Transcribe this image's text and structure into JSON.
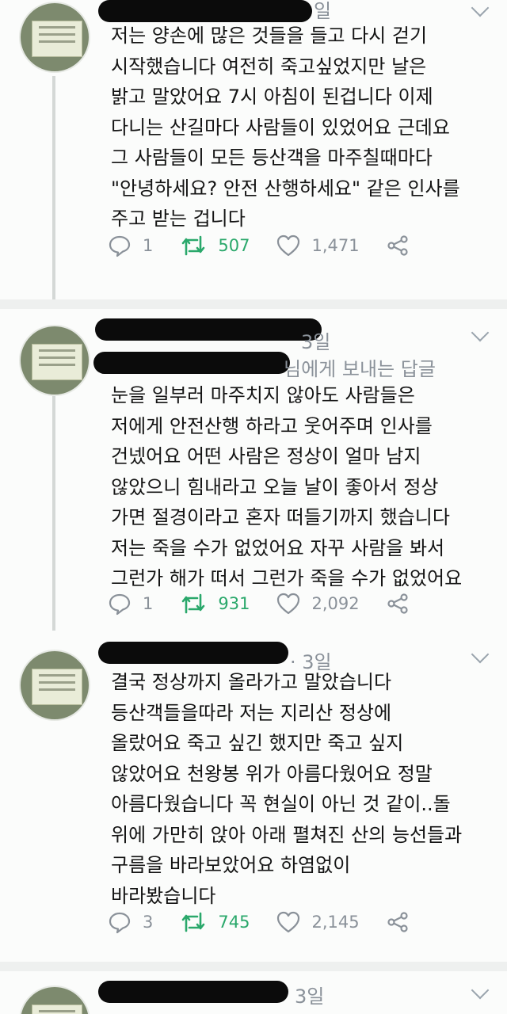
{
  "tweets": [
    {
      "time": "일",
      "body": [
        "저는 양손에 많은 것들을 들고 다시 걷기",
        "시작했습니다 여전히 죽고싶었지만 날은",
        "밝고 말았어요 7시 아침이 된겁니다 이제",
        "다니는 산길마다 사람들이 있었어요 근데요",
        "그 사람들이 모든 등산객을 마주칠때마다",
        "\"안녕하세요? 안전 산행하세요\" 같은 인사를",
        "주고 받는 겁니다"
      ],
      "replies": "1",
      "retweets": "507",
      "likes": "1,471"
    },
    {
      "time": "3일",
      "reply_to": "님에게 보내는 답글",
      "body": [
        "눈을 일부러 마주치지 않아도 사람들은",
        "저에게 안전산행 하라고 웃어주며 인사를",
        "건넸어요 어떤 사람은 정상이 얼마 남지",
        "않았으니 힘내라고 오늘 날이 좋아서 정상",
        "가면 절경이라고 혼자 떠들기까지 했습니다",
        "저는 죽을 수가 없었어요 자꾸 사람을 봐서",
        "그런가 해가 떠서 그런가 죽을 수가 없었어요"
      ],
      "replies": "1",
      "retweets": "931",
      "likes": "2,092"
    },
    {
      "time": "· 3일",
      "body": [
        "결국 정상까지 올라가고 말았습니다",
        "등산객들을따라 저는 지리산 정상에",
        "올랐어요 죽고 싶긴 했지만 죽고 싶지",
        "않았어요 천왕봉 위가 아름다웠어요 정말",
        "아름다웠습니다 꼭 현실이 아닌 것 같이..돌",
        "위에 가만히 앉아 아래 펼쳐진 산의 능선들과",
        "구름을 바라보았어요 하염없이",
        "바라봤습니다"
      ],
      "replies": "3",
      "retweets": "745",
      "likes": "2,145"
    },
    {
      "time": "3일"
    }
  ]
}
